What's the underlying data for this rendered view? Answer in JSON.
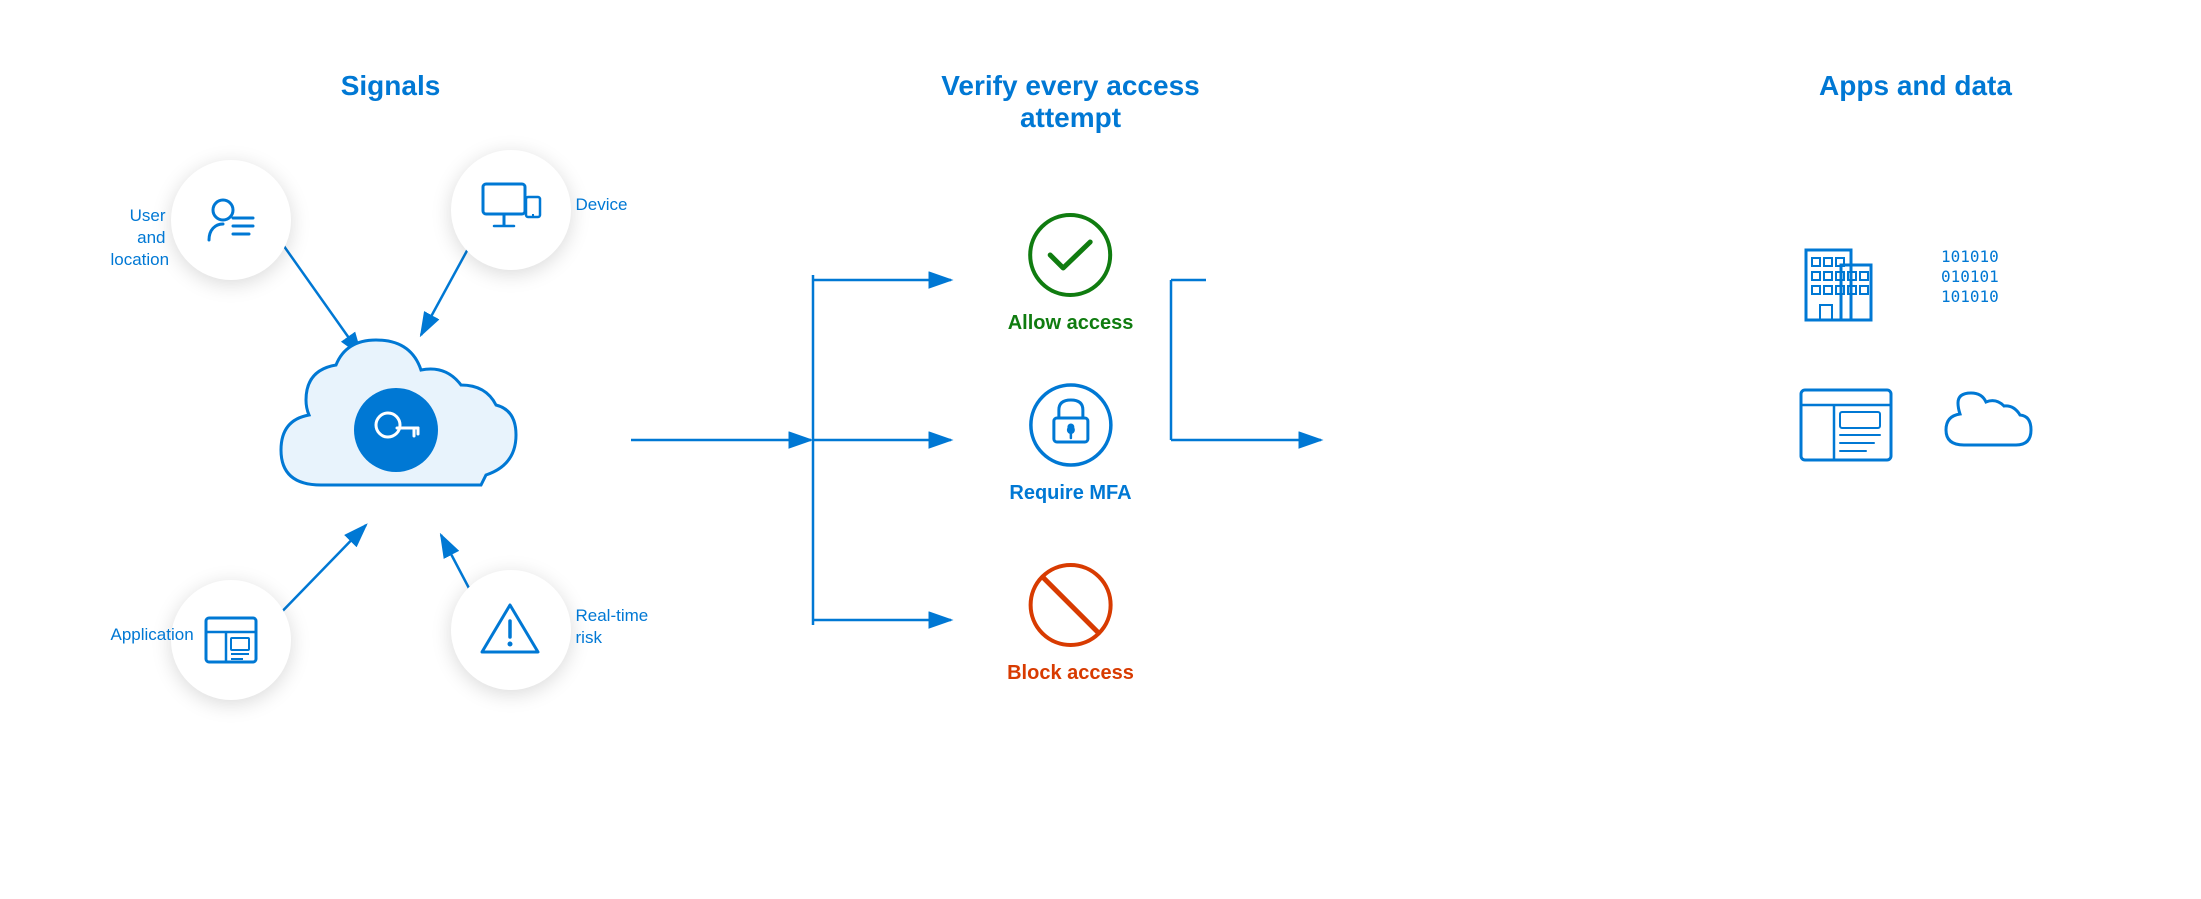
{
  "sections": {
    "signals": {
      "title": "Signals",
      "items": [
        {
          "id": "user-location",
          "label": "User and\nlocation",
          "icon": "user-list"
        },
        {
          "id": "device",
          "label": "Device",
          "icon": "device"
        },
        {
          "id": "application",
          "label": "Application",
          "icon": "app"
        },
        {
          "id": "realtime-risk",
          "label": "Real-time\nrisk",
          "icon": "warning"
        }
      ]
    },
    "verify": {
      "title": "Verify every access\nattempt",
      "outcomes": [
        {
          "id": "allow",
          "label": "Allow access",
          "type": "allow"
        },
        {
          "id": "mfa",
          "label": "Require MFA",
          "type": "mfa"
        },
        {
          "id": "block",
          "label": "Block access",
          "type": "block"
        }
      ]
    },
    "apps": {
      "title": "Apps and data",
      "items": [
        {
          "id": "building",
          "icon": "building"
        },
        {
          "id": "data",
          "icon": "binary-data"
        },
        {
          "id": "app-window",
          "icon": "app-window"
        },
        {
          "id": "cloud",
          "icon": "cloud"
        }
      ]
    }
  },
  "colors": {
    "blue": "#0078d4",
    "green": "#107c10",
    "orange": "#d83b01",
    "light_blue": "#e6f2fb"
  }
}
